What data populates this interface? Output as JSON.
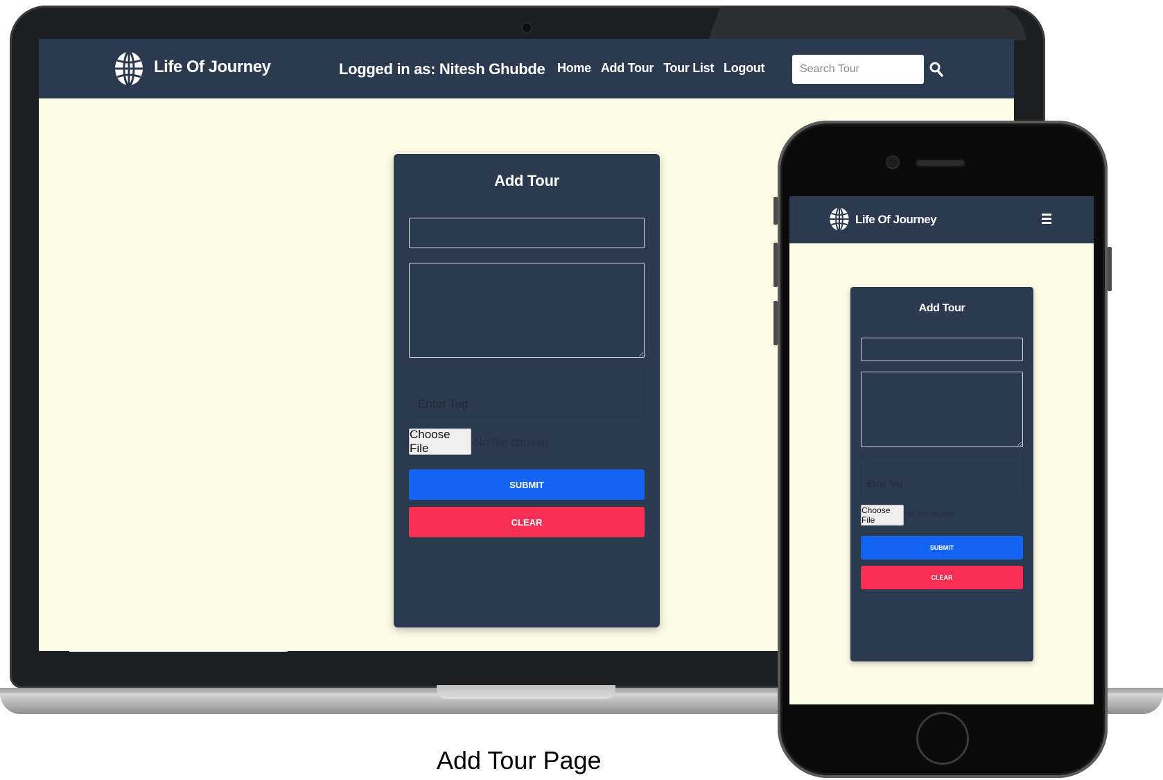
{
  "brand": {
    "title": "Life Of Journey"
  },
  "header": {
    "logged_in": "Logged in as: Nitesh Ghubde"
  },
  "nav": {
    "items": [
      {
        "label": "Home"
      },
      {
        "label": "Add Tour"
      },
      {
        "label": "Tour List"
      },
      {
        "label": "Logout"
      }
    ]
  },
  "search": {
    "placeholder": "Search Tour"
  },
  "form": {
    "title": "Add Tour",
    "tag_placeholder": "Enter Tag",
    "file_button": "Choose File",
    "file_status": "No file chosen",
    "submit_label": "SUBMIT",
    "clear_label": "CLEAR"
  },
  "caption": "Add Tour Page",
  "colors": {
    "navbar": "#2c3a4f",
    "page_bg": "#fdfce6",
    "submit": "#1464f4",
    "clear": "#f72f55"
  }
}
